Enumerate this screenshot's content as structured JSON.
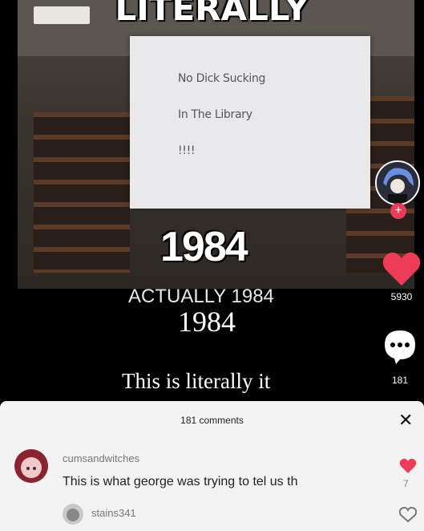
{
  "video": {
    "top_caption": "LITERALLY",
    "sign_lines": [
      "No Dick Sucking",
      "In The Library",
      "!!!!"
    ],
    "big_caption": "1984",
    "subcaption": "ACTUALLY 1984",
    "serif_caption": "1984",
    "bottom_caption": "This is literally it"
  },
  "sidebar": {
    "like_count": "5930",
    "comment_count": "181",
    "like_color": "#ee3b58"
  },
  "comments_sheet": {
    "title": "181 comments",
    "close_label": "✕",
    "comments": [
      {
        "username": "cumsandwitches",
        "text": "This is what george was trying to tel us th",
        "likes": "7",
        "liked": true
      },
      {
        "username": "stains341",
        "text": "",
        "likes": "",
        "liked": false
      }
    ]
  }
}
